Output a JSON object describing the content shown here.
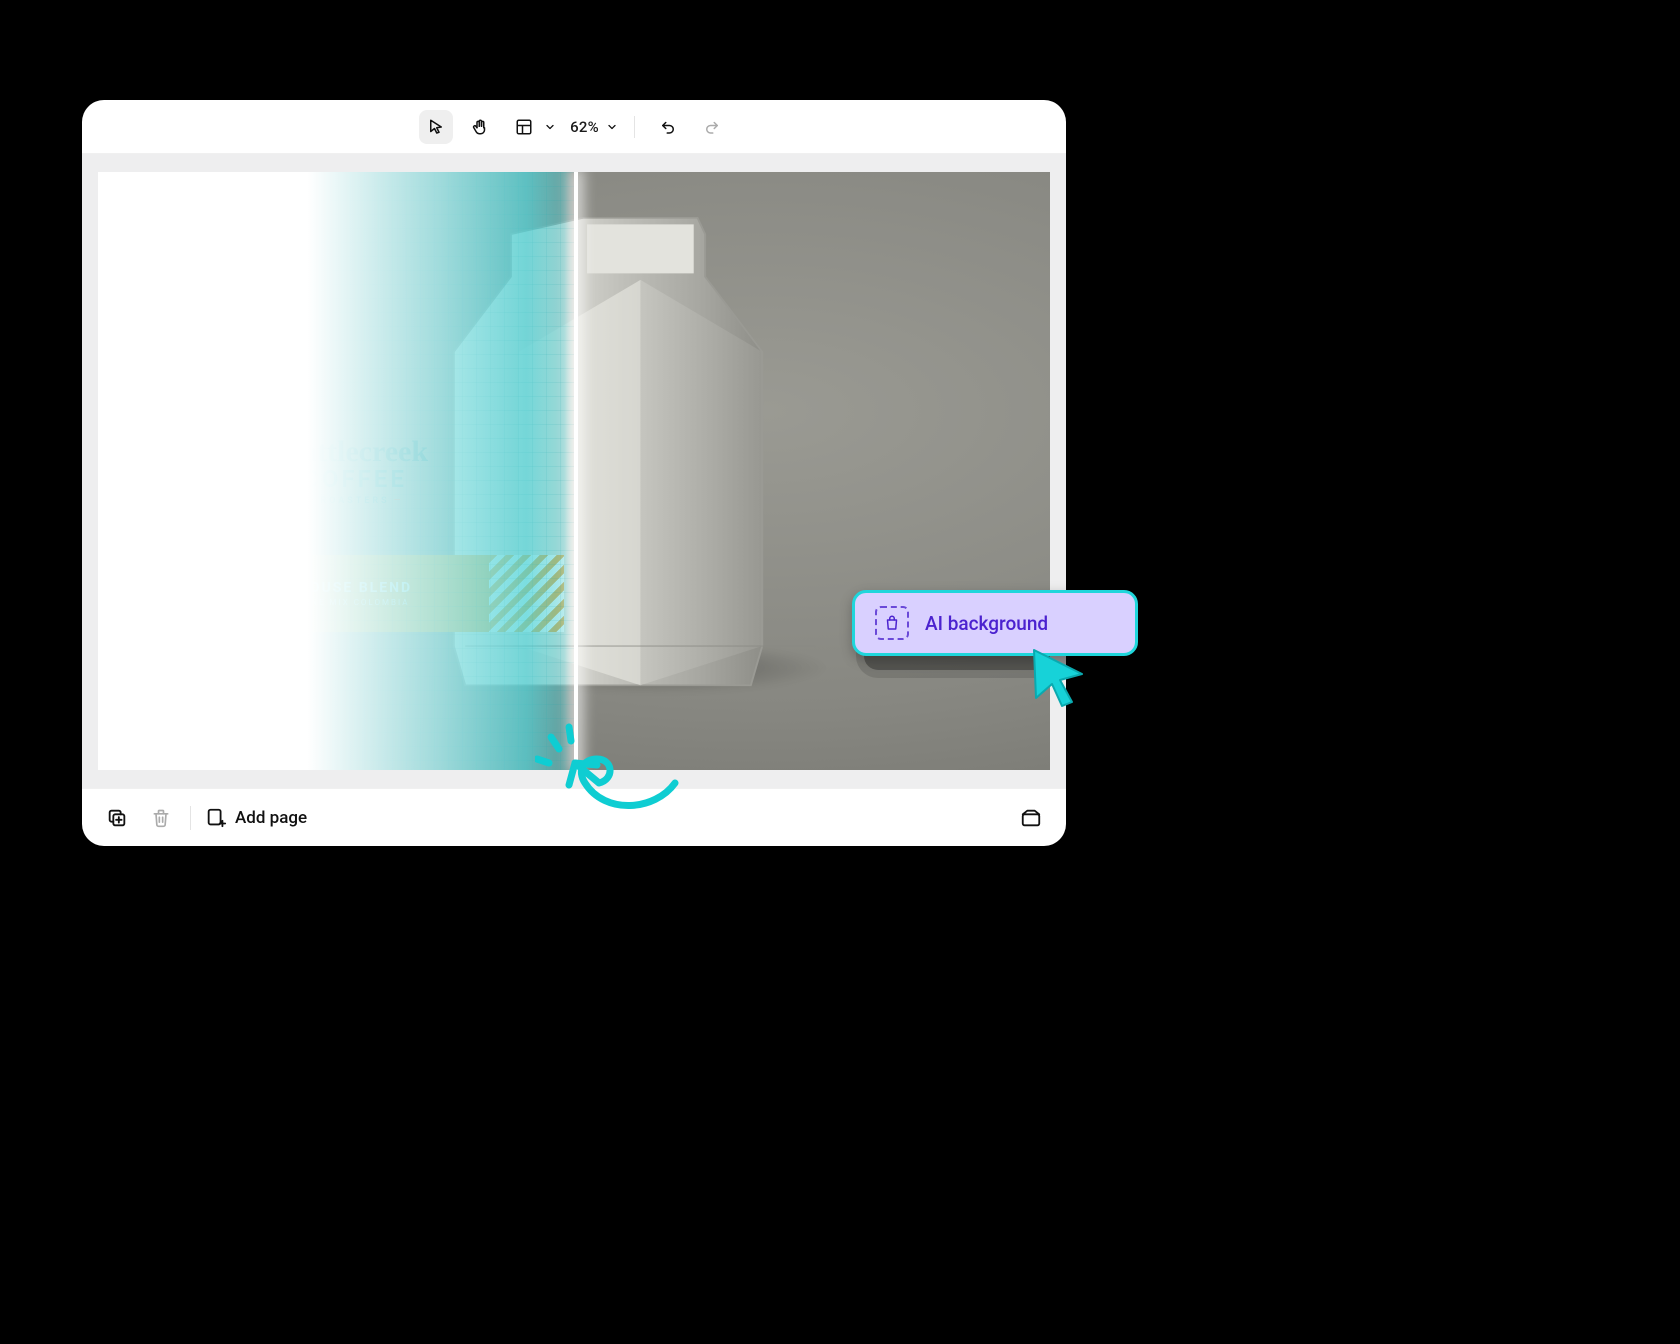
{
  "toolbar": {
    "zoom_level": "62%",
    "icons": {
      "pointer": "pointer-icon",
      "hand": "hand-icon",
      "layout": "layout-icon",
      "undo": "undo-icon",
      "redo": "redo-icon"
    }
  },
  "product_label": {
    "brand_script": "Battlecreek",
    "brand_main": "COFFEE",
    "brand_sub": "ROASTERS",
    "blend_name": "HOUSE BLEND",
    "blend_sub": "FINE MIX COLOMBIA"
  },
  "bottombar": {
    "add_page_label": "Add page"
  },
  "ai_button": {
    "label": "AI background"
  },
  "colors": {
    "accent_cyan": "#1fd6db",
    "ai_bg": "#d9d0ff",
    "ai_text": "#4b22cf"
  }
}
